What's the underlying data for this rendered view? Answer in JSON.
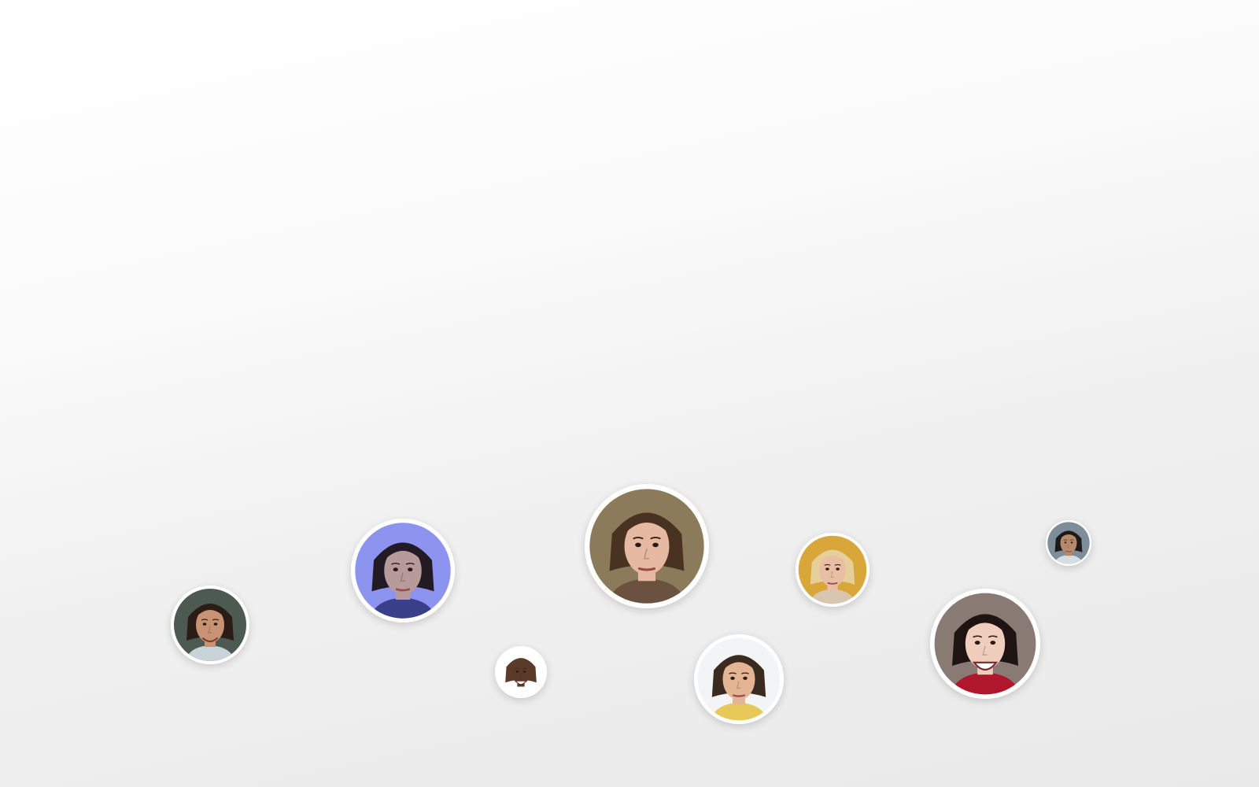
{
  "canvas": {
    "background_top": "#ffffff",
    "background_bottom": "#e9e9e9"
  },
  "avatars": [
    {
      "name": "avatar-man-smiling-green-background",
      "bg": "#4c5a52",
      "skin": "#c89374",
      "hair": "#2b1d16",
      "shirt": "#c9d3da",
      "expression": "smile"
    },
    {
      "name": "avatar-woman-blue-light",
      "bg": "#8d94f0",
      "skin": "#b79a9a",
      "hair": "#221b24",
      "shirt": "#3a3f8a",
      "expression": "neutral"
    },
    {
      "name": "avatar-man-laughing-bald",
      "bg": "#ffffff",
      "skin": "#5a3a28",
      "hair": "#5a3a28",
      "shirt": "#ffffff",
      "expression": "laugh"
    },
    {
      "name": "avatar-woman-long-brown-hair",
      "bg": "#8c7b5a",
      "skin": "#e6b9a3",
      "hair": "#4a3222",
      "shirt": "#6b5140",
      "expression": "neutral"
    },
    {
      "name": "avatar-young-man-white-background",
      "bg": "#f2f4f6",
      "skin": "#e3b595",
      "hair": "#3b2a20",
      "shirt": "#e7c95a",
      "expression": "neutral"
    },
    {
      "name": "avatar-blonde-woman-yellow-background",
      "bg": "#d9a63a",
      "skin": "#e8bfa2",
      "hair": "#e6cf9a",
      "shirt": "#d9c6b0",
      "expression": "neutral"
    },
    {
      "name": "avatar-woman-laughing-red-top",
      "bg": "#8a7a74",
      "skin": "#f0cdbd",
      "hair": "#1e1414",
      "shirt": "#b0162c",
      "expression": "laugh"
    },
    {
      "name": "avatar-man-small-grey-background",
      "bg": "#7d8e9a",
      "skin": "#b88a6c",
      "hair": "#1f1a18",
      "shirt": "#d8dde2",
      "expression": "neutral"
    }
  ]
}
